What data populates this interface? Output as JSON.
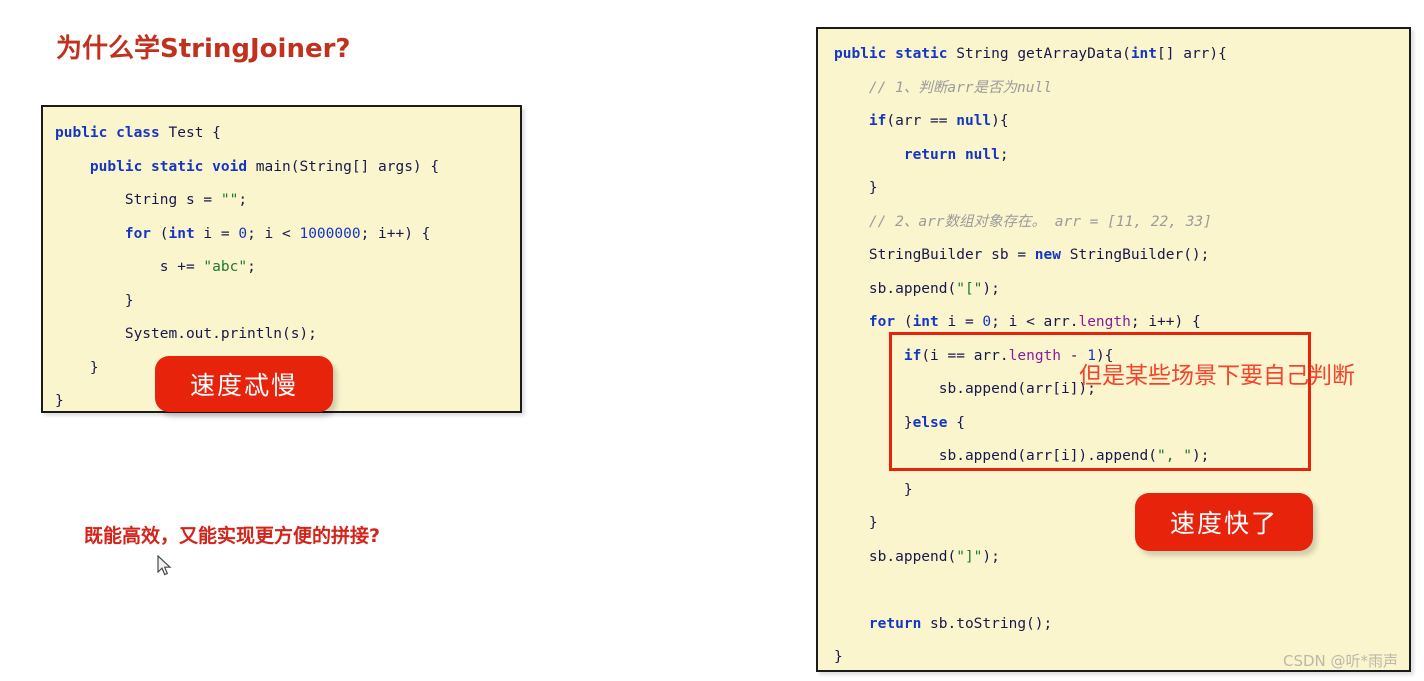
{
  "slide": {
    "title": "为什么学StringJoiner?",
    "bottom_question": "既能高效，又能实现更方便的拼接?",
    "watermark": "CSDN @听*雨声"
  },
  "colors": {
    "title_red": "#C0321E",
    "badge_red": "#E8230C",
    "annotation_red": "#E8230C",
    "annotation_text_red": "#F4442E",
    "code_background": "#FBF5CE",
    "code_border": "#1b1b1b",
    "keyword_blue": "#1536C4",
    "string_green": "#1E7A2E",
    "field_purple": "#8B1A9C",
    "comment_gray": "#9A9A9A",
    "code_text": "#17184B",
    "watermark_gray": "#BBB8A8"
  },
  "badges": {
    "slow": "速度忒慢",
    "fast": "速度快了"
  },
  "annotation": {
    "text": "但是某些场景下要自己判断"
  },
  "left_code": {
    "lines": [
      [
        {
          "t": "public ",
          "c": "kw"
        },
        {
          "t": "class ",
          "c": "kw"
        },
        {
          "t": "Test {",
          "c": "plain"
        }
      ],
      [
        {
          "t": "    ",
          "c": "plain"
        },
        {
          "t": "public ",
          "c": "kw"
        },
        {
          "t": "static ",
          "c": "kw"
        },
        {
          "t": "void ",
          "c": "kw"
        },
        {
          "t": "main(String[] args) {",
          "c": "plain"
        }
      ],
      [
        {
          "t": "        String s = ",
          "c": "plain"
        },
        {
          "t": "\"\"",
          "c": "str"
        },
        {
          "t": ";",
          "c": "plain"
        }
      ],
      [
        {
          "t": "        ",
          "c": "plain"
        },
        {
          "t": "for ",
          "c": "kw"
        },
        {
          "t": "(",
          "c": "plain"
        },
        {
          "t": "int ",
          "c": "kw"
        },
        {
          "t": "i = ",
          "c": "plain"
        },
        {
          "t": "0",
          "c": "num"
        },
        {
          "t": "; i < ",
          "c": "plain"
        },
        {
          "t": "1000000",
          "c": "num"
        },
        {
          "t": "; i++) {",
          "c": "plain"
        }
      ],
      [
        {
          "t": "            s += ",
          "c": "plain"
        },
        {
          "t": "\"abc\"",
          "c": "str"
        },
        {
          "t": ";",
          "c": "plain"
        }
      ],
      [
        {
          "t": "        }",
          "c": "plain"
        }
      ],
      [
        {
          "t": "        System.out.println(s);",
          "c": "plain"
        }
      ],
      [
        {
          "t": "    }",
          "c": "plain"
        }
      ],
      [
        {
          "t": "}",
          "c": "plain"
        }
      ]
    ]
  },
  "right_code": {
    "lines": [
      [
        {
          "t": "public ",
          "c": "kw"
        },
        {
          "t": "static ",
          "c": "kw"
        },
        {
          "t": "String ",
          "c": "plain"
        },
        {
          "t": "getArrayData(",
          "c": "plain"
        },
        {
          "t": "int",
          "c": "kw"
        },
        {
          "t": "[] arr){",
          "c": "plain"
        }
      ],
      [
        {
          "t": "    // 1、判断arr是否为null",
          "c": "cmt"
        }
      ],
      [
        {
          "t": "    ",
          "c": "plain"
        },
        {
          "t": "if",
          "c": "kw"
        },
        {
          "t": "(arr == ",
          "c": "plain"
        },
        {
          "t": "null",
          "c": "kw"
        },
        {
          "t": "){",
          "c": "plain"
        }
      ],
      [
        {
          "t": "        ",
          "c": "plain"
        },
        {
          "t": "return ",
          "c": "kw"
        },
        {
          "t": "null",
          "c": "kw"
        },
        {
          "t": ";",
          "c": "plain"
        }
      ],
      [
        {
          "t": "    }",
          "c": "plain"
        }
      ],
      [
        {
          "t": "    // 2、arr数组对象存在。 arr = [11, 22, 33]",
          "c": "cmt"
        }
      ],
      [
        {
          "t": "    StringBuilder sb = ",
          "c": "plain"
        },
        {
          "t": "new ",
          "c": "kw"
        },
        {
          "t": "StringBuilder();",
          "c": "plain"
        }
      ],
      [
        {
          "t": "    sb.append(",
          "c": "plain"
        },
        {
          "t": "\"[\"",
          "c": "str"
        },
        {
          "t": ");",
          "c": "plain"
        }
      ],
      [
        {
          "t": "    ",
          "c": "plain"
        },
        {
          "t": "for ",
          "c": "kw"
        },
        {
          "t": "(",
          "c": "plain"
        },
        {
          "t": "int ",
          "c": "kw"
        },
        {
          "t": "i = ",
          "c": "plain"
        },
        {
          "t": "0",
          "c": "num"
        },
        {
          "t": "; i < arr.",
          "c": "plain"
        },
        {
          "t": "length",
          "c": "fld"
        },
        {
          "t": "; i++) {",
          "c": "plain"
        }
      ],
      [
        {
          "t": "        ",
          "c": "plain"
        },
        {
          "t": "if",
          "c": "kw"
        },
        {
          "t": "(i == arr.",
          "c": "plain"
        },
        {
          "t": "length",
          "c": "fld"
        },
        {
          "t": " - ",
          "c": "plain"
        },
        {
          "t": "1",
          "c": "num"
        },
        {
          "t": "){",
          "c": "plain"
        }
      ],
      [
        {
          "t": "            sb.append(arr[i]);",
          "c": "plain"
        }
      ],
      [
        {
          "t": "        }",
          "c": "plain"
        },
        {
          "t": "else ",
          "c": "kw"
        },
        {
          "t": "{",
          "c": "plain"
        }
      ],
      [
        {
          "t": "            sb.append(arr[i]).append(",
          "c": "plain"
        },
        {
          "t": "\", \"",
          "c": "str"
        },
        {
          "t": ");",
          "c": "plain"
        }
      ],
      [
        {
          "t": "        }",
          "c": "plain"
        }
      ],
      [
        {
          "t": "    }",
          "c": "plain"
        }
      ],
      [
        {
          "t": "    sb.append(",
          "c": "plain"
        },
        {
          "t": "\"]\"",
          "c": "str"
        },
        {
          "t": ");",
          "c": "plain"
        }
      ],
      [
        {
          "t": "",
          "c": "plain"
        }
      ],
      [
        {
          "t": "    ",
          "c": "plain"
        },
        {
          "t": "return ",
          "c": "kw"
        },
        {
          "t": "sb.toString();",
          "c": "plain"
        }
      ],
      [
        {
          "t": "}",
          "c": "plain"
        }
      ]
    ]
  }
}
